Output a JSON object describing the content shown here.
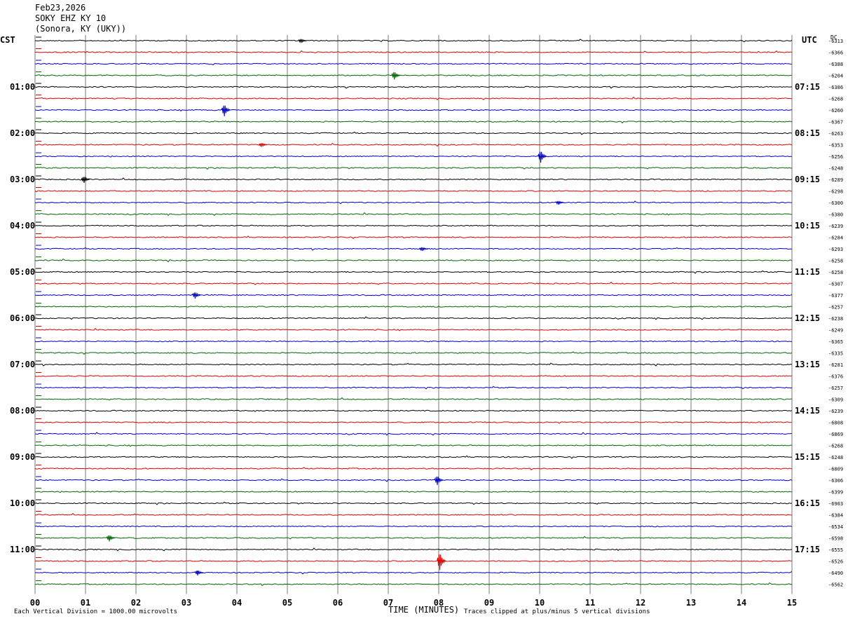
{
  "header": {
    "date": "Feb23,2026",
    "station": "SOKY EHZ KY 10",
    "location": "(Sonora, KY (UKY))"
  },
  "left_zone": "CST",
  "right_zone": "UTC",
  "dc_label": "DC",
  "xlabel": "TIME (MINUTES)",
  "footer": {
    "scale": "Each Vertical Division = 1000.00 microvolts",
    "clip": "Traces clipped at plus/minus 5 vertical divisions"
  },
  "colors": {
    "c0": "#000000",
    "c1": "#dd0000",
    "c2": "#0000bb",
    "c3": "#006600",
    "grid": "#777777"
  },
  "chart_data": {
    "type": "helicorder",
    "x_ticks": [
      "00",
      "01",
      "02",
      "03",
      "04",
      "05",
      "06",
      "07",
      "08",
      "09",
      "10",
      "11",
      "12",
      "13",
      "14",
      "15"
    ],
    "xlim": [
      0,
      15
    ],
    "row_minutes": 15,
    "left_hour_labels": [
      "01:00",
      "02:00",
      "03:00",
      "04:00",
      "05:00",
      "06:00",
      "07:00",
      "08:00",
      "09:00",
      "10:00",
      "11:00"
    ],
    "right_hour_labels": [
      "07:15",
      "08:15",
      "09:15",
      "10:15",
      "11:15",
      "12:15",
      "13:15",
      "14:15",
      "15:15",
      "16:15",
      "17:15"
    ],
    "hour_label_rows": [
      4,
      8,
      12,
      16,
      20,
      24,
      28,
      32,
      36,
      40,
      44
    ],
    "dc_offsets": [
      "-6313",
      "-6366",
      "-6388",
      "-6204",
      "-6386",
      "-6268",
      "-6260",
      "-6367",
      "-6263",
      "-6353",
      "-6256",
      "-6248",
      "-6289",
      "-6298",
      "-6300",
      "-6380",
      "-6239",
      "-6284",
      "-6293",
      "-6258",
      "-6258",
      "-6307",
      "-6377",
      "-6257",
      "-6238",
      "-6249",
      "-6365",
      "-6335",
      "-6281",
      "-6376",
      "-6257",
      "-6309",
      "-6239",
      "-6808",
      "-6869",
      "-6268",
      "-6248",
      "-6809",
      "-6306",
      "-6399",
      "-6903",
      "-6384",
      "-6534",
      "-6598",
      "-6555",
      "-6526",
      "-6490",
      "-6562"
    ],
    "events": [
      {
        "row": 0,
        "minute": 5.3,
        "amp": 3
      },
      {
        "row": 3,
        "minute": 7.15,
        "amp": 6
      },
      {
        "row": 6,
        "minute": 3.78,
        "amp": 9
      },
      {
        "row": 9,
        "minute": 4.52,
        "amp": 3
      },
      {
        "row": 10,
        "minute": 10.05,
        "amp": 9
      },
      {
        "row": 12,
        "minute": 1.0,
        "amp": 5
      },
      {
        "row": 14,
        "minute": 10.4,
        "amp": 3
      },
      {
        "row": 18,
        "minute": 7.7,
        "amp": 3
      },
      {
        "row": 22,
        "minute": 3.2,
        "amp": 5
      },
      {
        "row": 38,
        "minute": 8.0,
        "amp": 7
      },
      {
        "row": 43,
        "minute": 1.5,
        "amp": 5
      },
      {
        "row": 45,
        "minute": 8.05,
        "amp": 13
      },
      {
        "row": 46,
        "minute": 3.25,
        "amp": 4
      }
    ]
  }
}
